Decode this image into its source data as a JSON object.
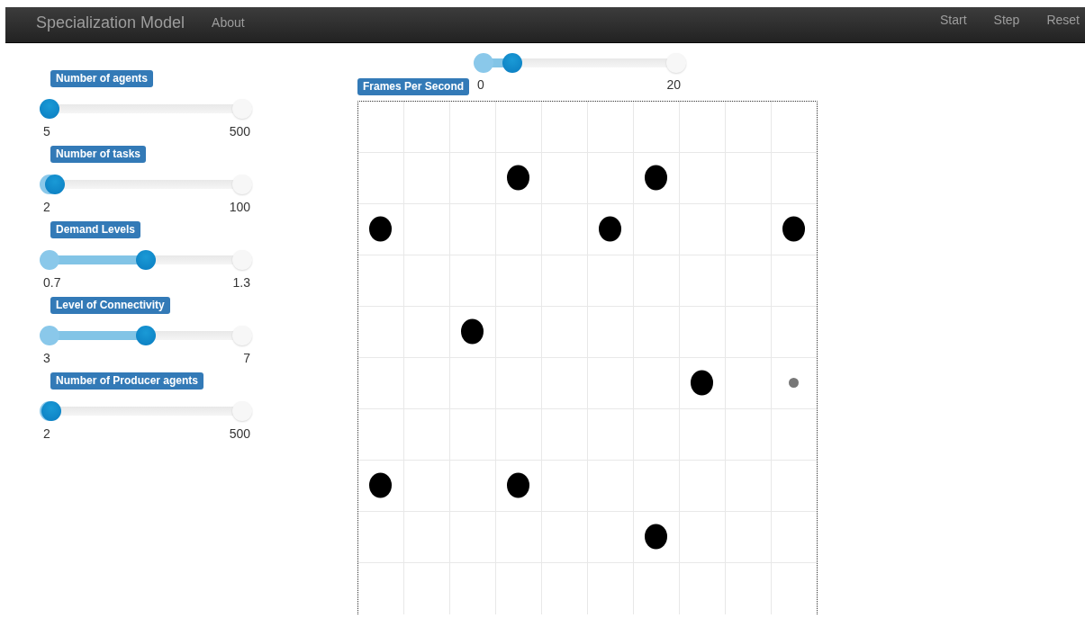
{
  "navbar": {
    "brand": "Specialization Model",
    "left_links": [
      "About"
    ],
    "right_links": [
      "Start",
      "Step",
      "Reset"
    ]
  },
  "sliders": [
    {
      "label": "Number of agents",
      "min": "5",
      "max": "500",
      "level": 0.0
    },
    {
      "label": "Number of tasks",
      "min": "2",
      "max": "100",
      "level": 0.03
    },
    {
      "label": "Demand Levels",
      "min": "0.7",
      "max": "1.3",
      "level": 0.5
    },
    {
      "label": "Level of Connectivity",
      "min": "3",
      "max": "7",
      "level": 0.5
    },
    {
      "label": "Number of Producer agents",
      "min": "2",
      "max": "500",
      "level": 0.01
    }
  ],
  "fps_slider": {
    "label": "Frames Per Second",
    "min": "0",
    "max": "20",
    "level": 0.15
  },
  "grid": {
    "rows": [
      {
        "cells": [
          {
            "kind": "empty"
          },
          {
            "kind": "empty"
          },
          {
            "kind": "empty"
          },
          {
            "kind": "empty"
          },
          {
            "kind": "empty"
          },
          {
            "kind": "empty"
          },
          {
            "kind": "empty"
          },
          {
            "kind": "empty"
          },
          {
            "kind": "empty"
          },
          {
            "kind": "empty"
          }
        ]
      },
      {
        "cells": [
          {
            "kind": "empty"
          },
          {
            "kind": "empty"
          },
          {
            "kind": "empty"
          },
          {
            "kind": "agent"
          },
          {
            "kind": "empty"
          },
          {
            "kind": "empty"
          },
          {
            "kind": "agent"
          },
          {
            "kind": "empty"
          },
          {
            "kind": "empty"
          },
          {
            "kind": "empty"
          }
        ]
      },
      {
        "cells": [
          {
            "kind": "agent"
          },
          {
            "kind": "empty"
          },
          {
            "kind": "empty"
          },
          {
            "kind": "empty"
          },
          {
            "kind": "empty"
          },
          {
            "kind": "agent"
          },
          {
            "kind": "empty"
          },
          {
            "kind": "empty"
          },
          {
            "kind": "empty"
          },
          {
            "kind": "agent"
          }
        ]
      },
      {
        "cells": [
          {
            "kind": "empty"
          },
          {
            "kind": "empty"
          },
          {
            "kind": "empty"
          },
          {
            "kind": "empty"
          },
          {
            "kind": "empty"
          },
          {
            "kind": "empty"
          },
          {
            "kind": "empty"
          },
          {
            "kind": "empty"
          },
          {
            "kind": "empty"
          },
          {
            "kind": "empty"
          }
        ]
      },
      {
        "cells": [
          {
            "kind": "empty"
          },
          {
            "kind": "empty"
          },
          {
            "kind": "agent"
          },
          {
            "kind": "empty"
          },
          {
            "kind": "empty"
          },
          {
            "kind": "empty"
          },
          {
            "kind": "empty"
          },
          {
            "kind": "empty"
          },
          {
            "kind": "empty"
          },
          {
            "kind": "empty"
          }
        ]
      },
      {
        "cells": [
          {
            "kind": "empty"
          },
          {
            "kind": "empty"
          },
          {
            "kind": "empty"
          },
          {
            "kind": "empty"
          },
          {
            "kind": "empty"
          },
          {
            "kind": "empty"
          },
          {
            "kind": "empty"
          },
          {
            "kind": "agent"
          },
          {
            "kind": "empty"
          },
          {
            "kind": "small"
          }
        ]
      },
      {
        "cells": [
          {
            "kind": "empty"
          },
          {
            "kind": "empty"
          },
          {
            "kind": "empty"
          },
          {
            "kind": "empty"
          },
          {
            "kind": "empty"
          },
          {
            "kind": "empty"
          },
          {
            "kind": "empty"
          },
          {
            "kind": "empty"
          },
          {
            "kind": "empty"
          },
          {
            "kind": "empty"
          }
        ]
      },
      {
        "cells": [
          {
            "kind": "agent"
          },
          {
            "kind": "empty"
          },
          {
            "kind": "empty"
          },
          {
            "kind": "agent"
          },
          {
            "kind": "empty"
          },
          {
            "kind": "empty"
          },
          {
            "kind": "empty"
          },
          {
            "kind": "empty"
          },
          {
            "kind": "empty"
          },
          {
            "kind": "empty"
          }
        ]
      },
      {
        "cells": [
          {
            "kind": "empty"
          },
          {
            "kind": "empty"
          },
          {
            "kind": "empty"
          },
          {
            "kind": "empty"
          },
          {
            "kind": "empty"
          },
          {
            "kind": "empty"
          },
          {
            "kind": "agent"
          },
          {
            "kind": "empty"
          },
          {
            "kind": "empty"
          },
          {
            "kind": "empty"
          }
        ]
      },
      {
        "cells": [
          {
            "kind": "empty"
          },
          {
            "kind": "empty"
          },
          {
            "kind": "empty"
          },
          {
            "kind": "empty"
          },
          {
            "kind": "empty"
          },
          {
            "kind": "empty"
          },
          {
            "kind": "empty"
          },
          {
            "kind": "empty"
          },
          {
            "kind": "empty"
          },
          {
            "kind": "empty"
          }
        ]
      }
    ]
  }
}
